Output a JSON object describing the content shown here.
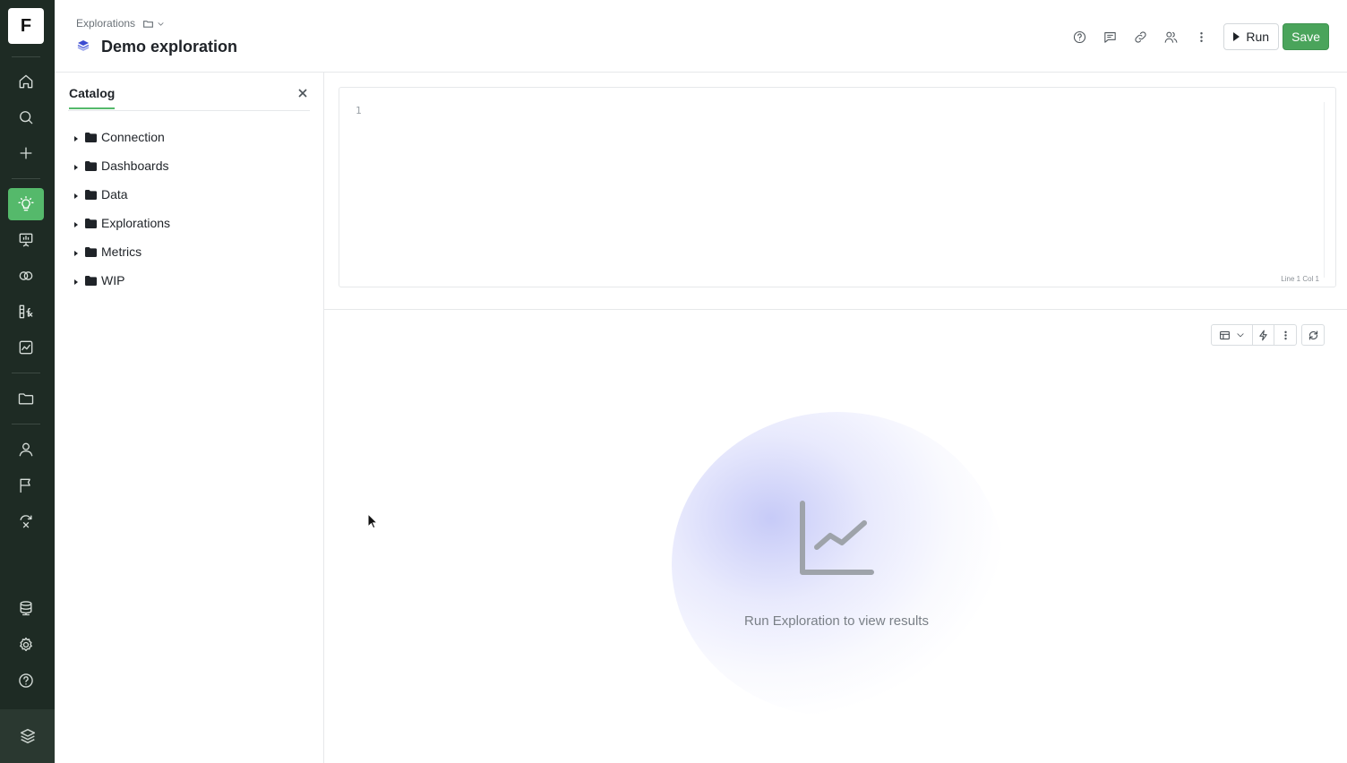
{
  "app": {
    "logo_letter": "F"
  },
  "nav": {
    "items": [
      {
        "name": "home-icon"
      },
      {
        "name": "search-icon"
      },
      {
        "name": "plus-icon"
      },
      {
        "name": "lightbulb-icon",
        "active": true
      },
      {
        "name": "presentation-icon"
      },
      {
        "name": "circles-icon"
      },
      {
        "name": "function-icon"
      },
      {
        "name": "chart-icon"
      },
      {
        "name": "folder-icon"
      },
      {
        "name": "user-icon"
      },
      {
        "name": "flag-icon"
      },
      {
        "name": "swap-icon"
      },
      {
        "name": "database-icon"
      },
      {
        "name": "gear-icon"
      },
      {
        "name": "help-icon"
      }
    ],
    "active_color": "#55b96b"
  },
  "header": {
    "breadcrumb": "Explorations",
    "title": "Demo exploration",
    "run_label": "Run",
    "save_label": "Save",
    "save_color": "#4aa45b"
  },
  "catalog": {
    "tab_label": "Catalog",
    "items": [
      {
        "label": "Connection"
      },
      {
        "label": "Dashboards"
      },
      {
        "label": "Data"
      },
      {
        "label": "Explorations"
      },
      {
        "label": "Metrics"
      },
      {
        "label": "WIP"
      }
    ]
  },
  "editor": {
    "line_number": "1",
    "status": "Line 1 Col 1"
  },
  "results": {
    "empty_message": "Run Exploration to view results"
  }
}
